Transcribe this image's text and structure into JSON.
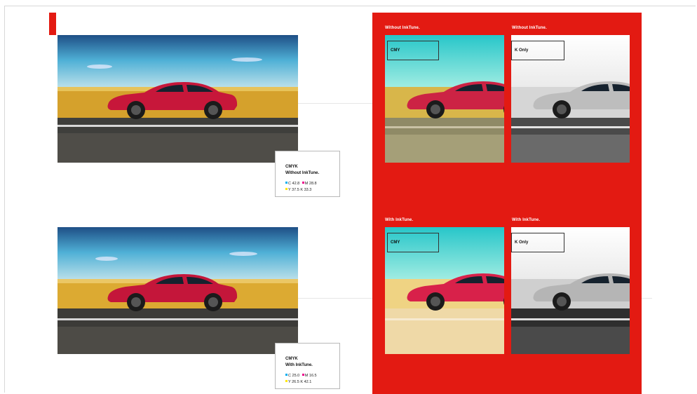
{
  "colors": {
    "accent": "#e31a12",
    "cyan": "#00aeef",
    "magenta": "#ec008c",
    "yellow": "#ffe600"
  },
  "left_column": {
    "top_caption": {
      "title": "CMYK",
      "subtitle": "Without InkTune.",
      "row1_c_label": "C",
      "row1_c_value": "42.8",
      "row1_m_label": "M",
      "row1_m_value": "28.8",
      "row2_y_label": "Y",
      "row2_y_value": "37.5",
      "row2_k_label": "K",
      "row2_k_value": "33.3"
    },
    "bottom_caption": {
      "title": "CMYK",
      "subtitle": "With InkTune.",
      "row1_c_label": "C",
      "row1_c_value": "25.0",
      "row1_m_label": "M",
      "row1_m_value": "16.5",
      "row2_y_label": "Y",
      "row2_y_value": "26.5",
      "row2_k_label": "K",
      "row2_k_value": "42.1"
    }
  },
  "right_panel": {
    "top_left_heading": "Without InkTune.",
    "top_right_heading": "Without InkTune.",
    "bottom_left_heading": "With InkTune.",
    "bottom_right_heading": "With InkTune.",
    "top_left_tag": "CMY",
    "top_right_tag": "K Only",
    "bottom_left_tag": "CMY",
    "bottom_right_tag": "K Only"
  }
}
